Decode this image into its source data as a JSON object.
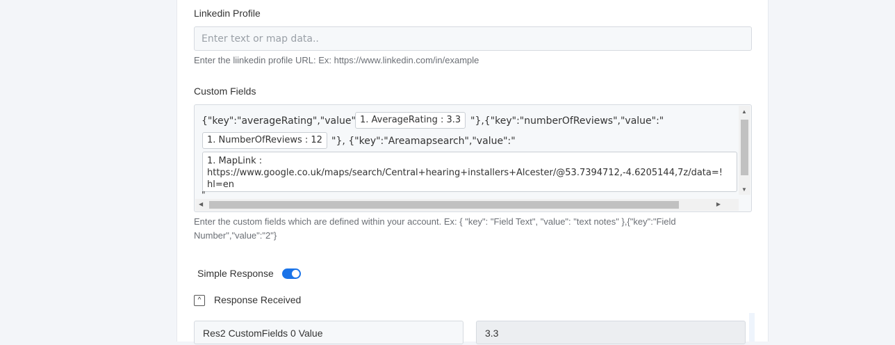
{
  "linkedin": {
    "label": "Linkedin Profile",
    "placeholder": "Enter text or map data..",
    "value": "",
    "help": "Enter the liinkedin profile URL: Ex: https://www.linkedin.com/in/example"
  },
  "custom_fields": {
    "label": "Custom Fields",
    "seg1": "{\"key\":\"averageRating\",\"value\":\"",
    "chip_rating": "1. AverageRating : 3.3",
    "seg2": "\"},{\"key\":\"numberOfReviews\",\"value\":\"",
    "chip_reviews": "1. NumberOfReviews : 12",
    "seg3": "\"}, {\"key\":\"Areamapsearch\",\"value\":\"",
    "maplink_line1": "1. MapLink :",
    "maplink_line2": "https://www.google.co.uk/maps/search/Central+hearing+installers+Alcester/@53.7394712,-4.6205144,7z/data=!",
    "maplink_line3": "hl=en",
    "trailing": "\"",
    "help_line1": "Enter the custom fields which are defined within your account. Ex: { \"key\": \"Field Text\", \"value\": \"text notes\" },{\"key\":\"Field",
    "help_line2": "Number\",\"value\":\"2\"}"
  },
  "simple_response": {
    "label": "Simple Response",
    "enabled": true,
    "accent": "#1a73e8"
  },
  "response_received": {
    "label": "Response Received",
    "collapse_icon": "chevron-up-icon",
    "rows": [
      {
        "key": "Res2 CustomFields 0 Value",
        "value": "3.3"
      }
    ]
  }
}
